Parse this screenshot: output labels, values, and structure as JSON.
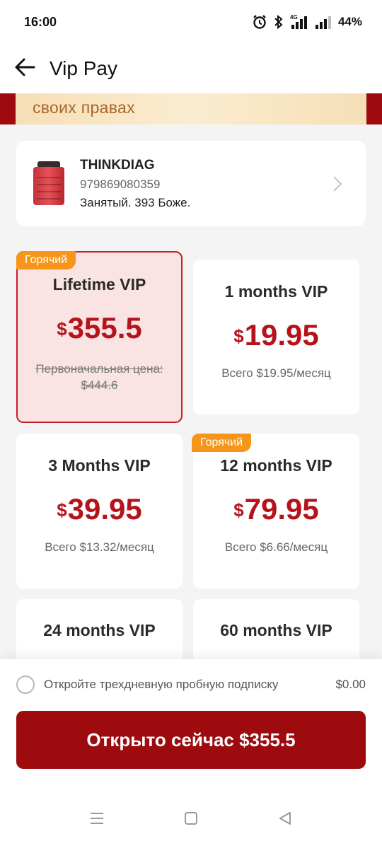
{
  "status_bar": {
    "time": "16:00",
    "network": "4G",
    "battery": "44%",
    "icons": [
      "alarm-icon",
      "bluetooth-icon",
      "signal-icon",
      "signal-icon",
      "battery-icon"
    ]
  },
  "header": {
    "title": "Vip Pay",
    "back_icon": "arrow-left-icon"
  },
  "banner": {
    "text": "своих правах"
  },
  "device": {
    "name": "THINKDIAG",
    "serial": "979869080359",
    "status": "Занятый. 393 Боже."
  },
  "plans": [
    {
      "title": "Lifetime VIP",
      "currency": "$",
      "price": "355.5",
      "original_label": "Первоначальная цена:",
      "original_price": "$444.6",
      "badge": "Горячий",
      "selected": true
    },
    {
      "title": "1 months VIP",
      "currency": "$",
      "price": "19.95",
      "note": "Всего $19.95/месяц"
    },
    {
      "title": "3 Months VIP",
      "currency": "$",
      "price": "39.95",
      "note": "Всего $13.32/месяц"
    },
    {
      "title": "12 months VIP",
      "currency": "$",
      "price": "79.95",
      "note": "Всего $6.66/месяц",
      "badge": "Горячий"
    },
    {
      "title": "24 months VIP"
    },
    {
      "title": "60 months VIP"
    }
  ],
  "trial": {
    "label": "Откройте трехдневную пробную подписку",
    "price": "$0.00",
    "checked": false
  },
  "cta": {
    "label": "Открыто сейчас $355.5"
  },
  "colors": {
    "brand": "#9e0b0f",
    "price": "#b5131b",
    "badge": "#f5961b",
    "selected_bg": "#f9e3e3"
  }
}
